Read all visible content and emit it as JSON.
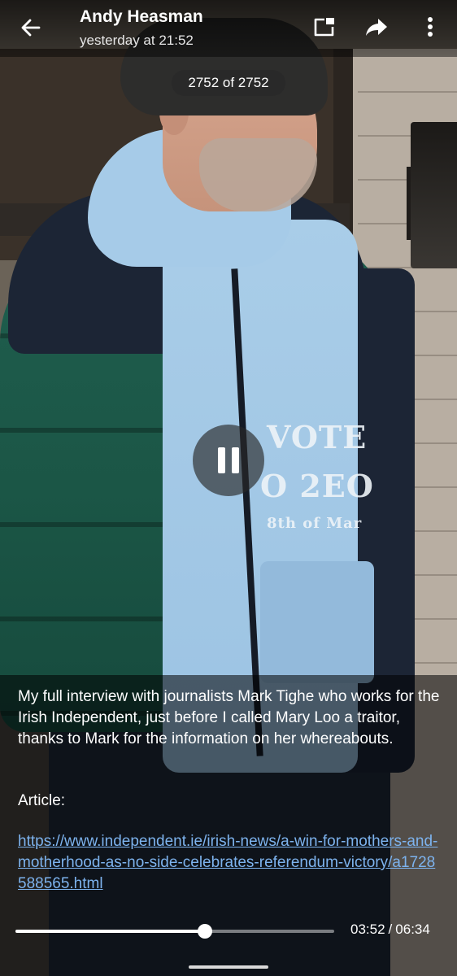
{
  "header": {
    "sender": "Andy Heasman",
    "timestamp": "yesterday at 21:52",
    "back_icon": "arrow-left-icon",
    "pip_icon": "picture-in-picture-icon",
    "share_icon": "share-forward-icon",
    "more_icon": "more-vertical-icon"
  },
  "media": {
    "counter": "2752 of 2752",
    "state": "playing",
    "pause_icon": "pause-icon",
    "shirt_lines": [
      "VOTE",
      "O 2EO",
      "8th of Mar"
    ]
  },
  "caption": {
    "text": "My full interview with journalists Mark Tighe who works for the Irish Independent, just before I called Mary Loo a traitor, thanks to Mark for the information on her whereabouts.",
    "article_label": "Article:",
    "link": "https://www.independent.ie/irish-news/a-win-for-mothers-and-motherhood-as-no-side-celebrates-referendum-victory/a1728588565.html"
  },
  "player": {
    "current_time": "03:52",
    "separator": "/",
    "duration": "06:34",
    "progress_fraction": 0.594
  },
  "colors": {
    "link": "#7db3ee",
    "overlay": "#000000",
    "progress": "#ffffff"
  }
}
